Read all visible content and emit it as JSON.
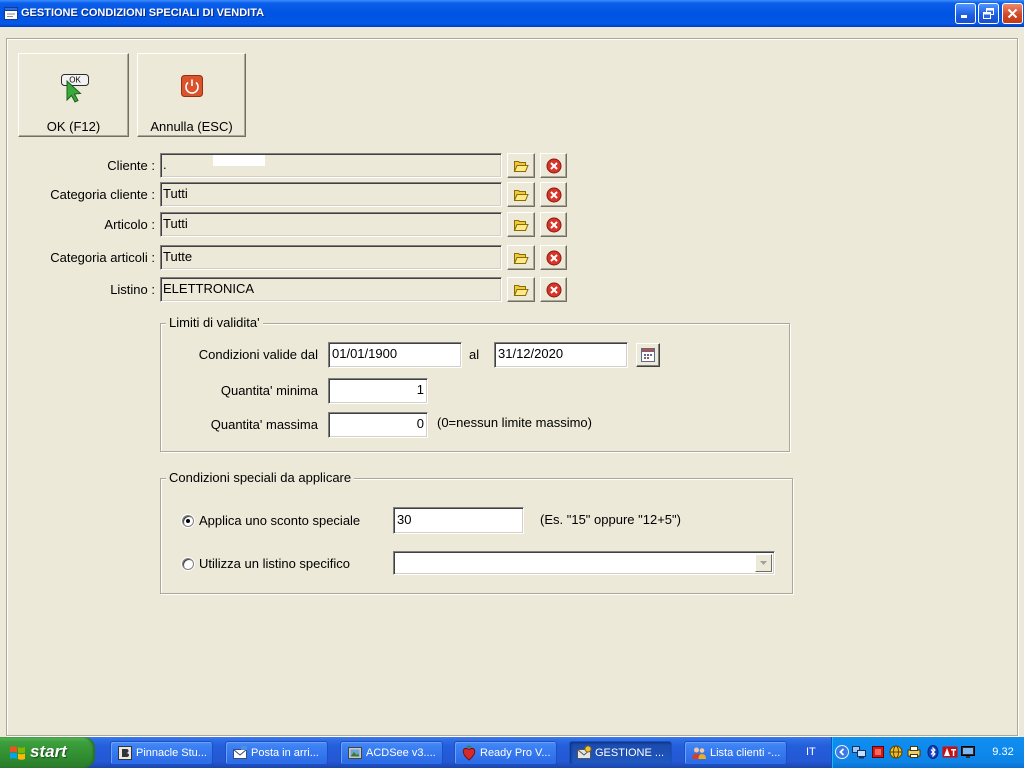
{
  "window": {
    "title": "GESTIONE CONDIZIONI SPECIALI DI VENDITA",
    "icon": "form-icon",
    "controls": [
      "minimize-icon",
      "restore-icon",
      "close-icon"
    ]
  },
  "toolbar": {
    "ok_label": "OK (F12)",
    "ok_icon": "ok-cursor-icon",
    "ok_icon_text": "OK",
    "cancel_label": "Annulla (ESC)",
    "cancel_icon": "power-icon"
  },
  "fields": [
    {
      "label": "Cliente :",
      "value": "."
    },
    {
      "label": "Categoria cliente :",
      "value": "Tutti"
    },
    {
      "label": "Articolo :",
      "value": "Tutti"
    },
    {
      "label": "Categoria articoli :",
      "value": "Tutte"
    },
    {
      "label": "Listino :",
      "value": "ELETTRONICA"
    }
  ],
  "field_buttons": {
    "browse_icon": "folder-icon",
    "clear_icon": "delete-icon"
  },
  "validity": {
    "legend": "Limiti di validita'",
    "from_label": "Condizioni valide dal",
    "from_value": "01/01/1900",
    "to_label": "al",
    "to_value": "31/12/2020",
    "calendar_icon": "calendar-icon",
    "min_label": "Quantita' minima",
    "min_value": "1",
    "max_label": "Quantita' massima",
    "max_value": "0",
    "max_hint": "(0=nessun limite massimo)"
  },
  "special": {
    "legend": "Condizioni speciali da applicare",
    "discount_label": "Applica uno sconto speciale",
    "discount_value": "30",
    "discount_hint": "(Es. \"15\" oppure \"12+5\")",
    "discount_selected": true,
    "pricelist_label": "Utilizza un listino specifico",
    "pricelist_value": "",
    "pricelist_selected": false
  },
  "taskbar": {
    "start_label": "start",
    "tasks": [
      {
        "label": "Pinnacle Stu...",
        "icon": "pinnacle-icon",
        "active": false
      },
      {
        "label": "Posta in arri...",
        "icon": "mail-icon",
        "active": false
      },
      {
        "label": "ACDSee v3....",
        "icon": "acdsee-icon",
        "active": false
      },
      {
        "label": "Ready Pro V...",
        "icon": "ready-pro-icon",
        "active": false
      },
      {
        "label": "GESTIONE ...",
        "icon": "gestione-icon",
        "active": true
      },
      {
        "label": "Lista clienti -...",
        "icon": "contacts-icon",
        "active": false
      }
    ],
    "language": "IT",
    "tray_icons": [
      "show-hidden-icon",
      "network-icon",
      "antivirus-icon",
      "globe-icon",
      "printer-icon",
      "bluetooth-icon",
      "ati-icon",
      "display-icon"
    ],
    "clock": "9.32"
  },
  "colors": {
    "title_bar": "#0054e3",
    "window_bg": "#ece9d8",
    "taskbar": "#245edb",
    "start_button": "#3d9f3d",
    "close_button": "#d34a27",
    "delete_icon": "#d8342a",
    "folder_icon": "#f7d54a"
  }
}
